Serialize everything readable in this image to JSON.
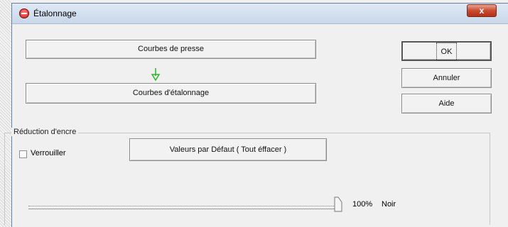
{
  "window": {
    "title": "Étalonnage",
    "close_label": "x"
  },
  "buttons": {
    "press_curves": "Courbes de presse",
    "calibration_curves": "Courbes d'étalonnage",
    "ok": "OK",
    "cancel": "Annuler",
    "help": "Aide"
  },
  "ink_reduction": {
    "group_label": "Réduction d'encre",
    "lock_label": "Verrouiller",
    "lock_checked": false,
    "defaults_button": "Valeurs par Défaut ( Tout éffacer )",
    "slider_percent": "100%",
    "slider_fraction": 1.0,
    "color_label": "Noir"
  }
}
